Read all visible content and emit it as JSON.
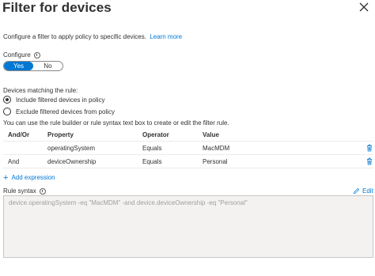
{
  "panel": {
    "title": "Filter for devices"
  },
  "intro": {
    "text": "Configure a filter to apply policy to specific devices.",
    "link": "Learn more"
  },
  "configure": {
    "label": "Configure",
    "options": [
      "Yes",
      "No"
    ],
    "selected": "Yes"
  },
  "matching": {
    "label": "Devices matching the rule:",
    "options": [
      {
        "label": "Include filtered devices in policy",
        "checked": true
      },
      {
        "label": "Exclude filtered devices from policy",
        "checked": false
      }
    ]
  },
  "builder_note": "You can use the rule builder or rule syntax text box to create or edit the filter rule.",
  "rules_table": {
    "headers": [
      "And/Or",
      "Property",
      "Operator",
      "Value"
    ],
    "rows": [
      {
        "andor": "",
        "property": "operatingSystem",
        "operator": "Equals",
        "value": "MacMDM"
      },
      {
        "andor": "And",
        "property": "deviceOwnership",
        "operator": "Equals",
        "value": "Personal"
      }
    ]
  },
  "add_expression": "Add expression",
  "rule_syntax": {
    "label": "Rule syntax",
    "edit_label": "Edit",
    "value": "device.operatingSystem -eq \"MacMDM\" -and device.deviceOwnership -eq \"Personal\""
  },
  "colors": {
    "accent": "#0078d4",
    "text": "#323130",
    "disabled_bg": "#f3f2f1"
  }
}
